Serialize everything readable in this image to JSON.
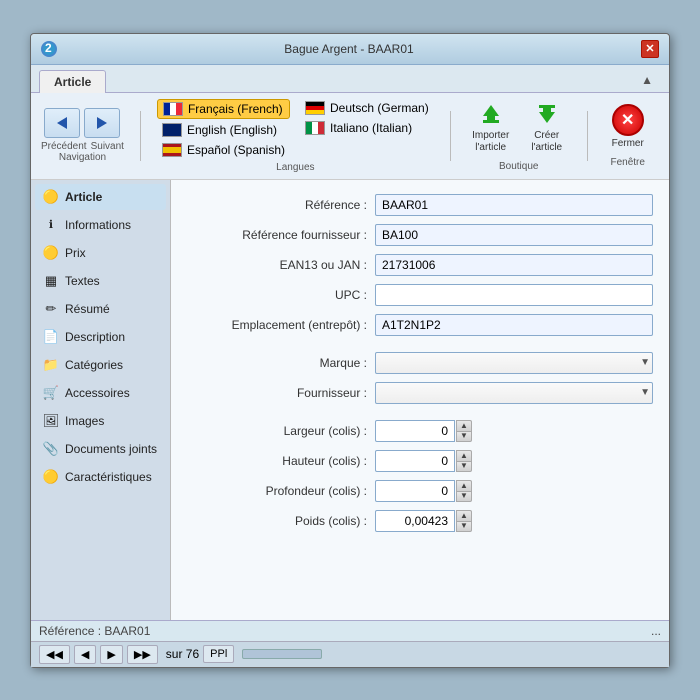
{
  "window": {
    "title": "Bague Argent - BAAR01",
    "close_btn": "✕"
  },
  "tabs": [
    {
      "label": "Article",
      "active": true
    },
    {
      "label": "▲"
    }
  ],
  "toolbar": {
    "nav": {
      "prev_label": "Précédent",
      "next_label": "Suivant",
      "group_label": "Navigation"
    },
    "languages": {
      "group_label": "Langues",
      "items": [
        {
          "code": "fr",
          "label": "Français (French)",
          "selected": true
        },
        {
          "code": "en",
          "label": "English (English)",
          "selected": false
        },
        {
          "code": "es",
          "label": "Español (Spanish)",
          "selected": false
        },
        {
          "code": "de",
          "label": "Deutsch (German)",
          "selected": false
        },
        {
          "code": "it",
          "label": "Italiano (Italian)",
          "selected": false
        }
      ]
    },
    "boutique": {
      "group_label": "Boutique",
      "import_label": "Importer\nl'article",
      "creer_label": "Créer\nl'article"
    },
    "fenetre": {
      "group_label": "Fenêtre",
      "fermer_label": "Fermer"
    }
  },
  "sidebar": {
    "items": [
      {
        "id": "article",
        "label": "Article",
        "icon": "🟡",
        "active": true
      },
      {
        "id": "informations",
        "label": "Informations",
        "icon": "ℹ️",
        "active": false
      },
      {
        "id": "prix",
        "label": "Prix",
        "icon": "🟡",
        "active": false
      },
      {
        "id": "textes",
        "label": "Textes",
        "icon": "▦",
        "active": false
      },
      {
        "id": "resume",
        "label": "Résumé",
        "icon": "✏️",
        "active": false
      },
      {
        "id": "description",
        "label": "Description",
        "icon": "📄",
        "active": false
      },
      {
        "id": "categories",
        "label": "Catégories",
        "icon": "📁",
        "active": false
      },
      {
        "id": "accessoires",
        "label": "Accessoires",
        "icon": "🛒",
        "active": false
      },
      {
        "id": "images",
        "label": "Images",
        "icon": "🖼️",
        "active": false
      },
      {
        "id": "documents",
        "label": "Documents joints",
        "icon": "📎",
        "active": false
      },
      {
        "id": "caracteristiques",
        "label": "Caractéristiques",
        "icon": "🟡",
        "active": false
      }
    ]
  },
  "form": {
    "fields": [
      {
        "id": "reference",
        "label": "Référence :",
        "value": "BAAR01",
        "type": "text"
      },
      {
        "id": "ref_fournisseur",
        "label": "Référence fournisseur :",
        "value": "BA100",
        "type": "text"
      },
      {
        "id": "ean13",
        "label": "EAN13 ou JAN :",
        "value": "21731006",
        "type": "text"
      },
      {
        "id": "upc",
        "label": "UPC :",
        "value": "",
        "type": "text"
      },
      {
        "id": "emplacement",
        "label": "Emplacement (entrepôt) :",
        "value": "A1T2N1P2",
        "type": "text"
      },
      {
        "id": "marque",
        "label": "Marque :",
        "value": "",
        "type": "select"
      },
      {
        "id": "fournisseur",
        "label": "Fournisseur :",
        "value": "",
        "type": "select"
      },
      {
        "id": "largeur",
        "label": "Largeur (colis) :",
        "value": "0",
        "type": "spinner"
      },
      {
        "id": "hauteur",
        "label": "Hauteur (colis) :",
        "value": "0",
        "type": "spinner"
      },
      {
        "id": "profondeur",
        "label": "Profondeur (colis) :",
        "value": "0",
        "type": "spinner"
      },
      {
        "id": "poids",
        "label": "Poids (colis) :",
        "value": "0,00423",
        "type": "spinner"
      }
    ]
  },
  "status_bar": {
    "text": "Référence : BAAR01",
    "dots": "..."
  },
  "pagination": {
    "sur": "sur 76",
    "btns": [
      "◀◀",
      "◀",
      "▶",
      "▶▶",
      "PPl"
    ]
  }
}
